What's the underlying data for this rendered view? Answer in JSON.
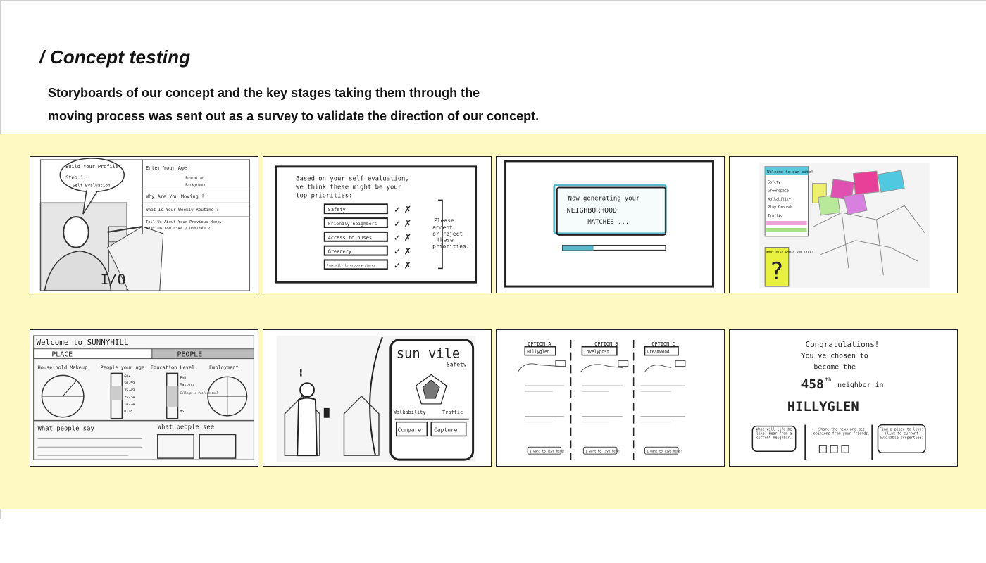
{
  "header": {
    "title": "/ Concept testing",
    "description_line1": "Storyboards of our concept and the key stages taking them through the",
    "description_line2": "moving process was sent out as a survey to validate the direction of our concept."
  },
  "sketch1": {
    "bubble_line1": "Build Your Profile!",
    "bubble_line2": "Step 1:",
    "bubble_line3": "Self Evaluation",
    "q1": "Enter Your Age",
    "q1b": "Education",
    "q1c": "Background",
    "q2": "Why Are You Moving ?",
    "q3": "What Is Your Weekly Routine ?",
    "q4": "Tell Us About Your Previous Home.",
    "q5": "What Do You Like / Dislike ?"
  },
  "sketch2": {
    "intro_line1": "Based on your self-evaluation,",
    "intro_line2": "we think these might be your",
    "intro_line3": "top priorities:",
    "priorities": [
      "Safety",
      "Friendly neighbors",
      "Access to buses",
      "Greenery",
      "Proximity to grocery stores"
    ],
    "note_line1": "Please",
    "note_line2": "accept",
    "note_line3": "or reject",
    "note_line4": "these",
    "note_line5": "priorities."
  },
  "sketch3": {
    "line1": "Now generating your",
    "line2": "NEIGHBORHOOD",
    "line3": "MATCHES ...",
    "progress": 0.3
  },
  "sketch4": {
    "panel_title": "Welcome to our site!",
    "rows": [
      "Safety",
      "Greenspace",
      "Walkability",
      "Play Grounds",
      "Traffic"
    ],
    "prompt": "What else would you like?"
  },
  "sketch5": {
    "title": "Welcome to SUNNYHILL",
    "tab_place": "PLACE",
    "tab_people": "PEOPLE",
    "col1": "House hold Makeup",
    "col2": "People your age",
    "col3": "Education Level",
    "col4": "Employment",
    "ages": [
      "60+",
      "50-59",
      "35-49",
      "25-34",
      "18-24",
      "0-18"
    ],
    "edu": [
      "PhD",
      "Masters",
      "College or Professional",
      "HS"
    ],
    "says": "What people say",
    "sees": "What people see"
  },
  "sketch6": {
    "app_title": "sun vile",
    "label_top": "Safety",
    "label_left": "Walkability",
    "label_right": "Traffic",
    "btn_compare": "Compare",
    "btn_capture": "Capture"
  },
  "sketch7": {
    "options": [
      "OPTION A",
      "OPTION B",
      "OPTION C"
    ],
    "names": [
      "Hillyglen",
      "Lovelypost",
      "Dreamwood"
    ],
    "button": "I want to live here!"
  },
  "sketch8": {
    "line1": "Congratulations!",
    "line2": "You've chosen to",
    "line3": "become the",
    "rank": "458",
    "rank_suffix": "th",
    "line4": "neighbor in",
    "place": "HILLYGLEN",
    "box1": "What will life be like? Hear from a current neighbor.",
    "box2": "Share the news and get opinions from your friends.",
    "box3": "Find a place to live! (link to current available properties)"
  }
}
